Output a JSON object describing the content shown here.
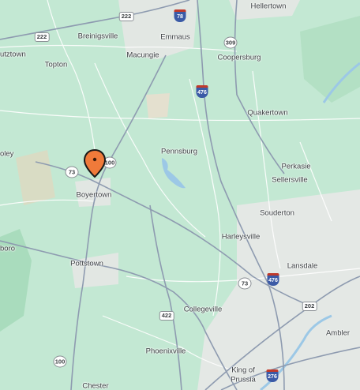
{
  "places": {
    "hellertown": "Hellertown",
    "breinigsville": "Breinigsville",
    "emmaus": "Emmaus",
    "kutztown": "utztown",
    "topton": "Topton",
    "macungie": "Macungie",
    "coopersburg": "Coopersburg",
    "quakertown": "Quakertown",
    "pennsburg": "Pennsburg",
    "perkasie": "Perkasie",
    "sellersville": "Sellersville",
    "boyertown": "Boyertown",
    "souderton": "Souderton",
    "harleysville": "Harleysville",
    "lansdale": "Lansdale",
    "pottstown": "Pottstown",
    "boro": "boro",
    "oley": "oley",
    "collegeville": "Collegeville",
    "phoenixville": "Phoenixville",
    "ambler": "Ambler",
    "king_of_prussia_1": "King of",
    "king_of_prussia_2": "Prussia",
    "chester": "Chester"
  },
  "shields": {
    "us222": "222",
    "i78": "78",
    "pa309": "309",
    "pa222": "222",
    "i476_north": "476",
    "pa100": "100",
    "pa73_west": "73",
    "pa73_east": "73",
    "i476_south": "476",
    "us202": "202",
    "us422": "422",
    "pa100_south": "100",
    "i276": "276"
  },
  "marker": {
    "icon": "map-pin-icon",
    "color": "#f07a3a",
    "location": "Boyertown"
  },
  "colors": {
    "land": "#c3e8d3",
    "forest": "#a9dcbd",
    "urban": "#e8ece9",
    "water": "#9cc8e6",
    "road_major": "#8e9bb0",
    "road_minor": "#ffffff"
  }
}
